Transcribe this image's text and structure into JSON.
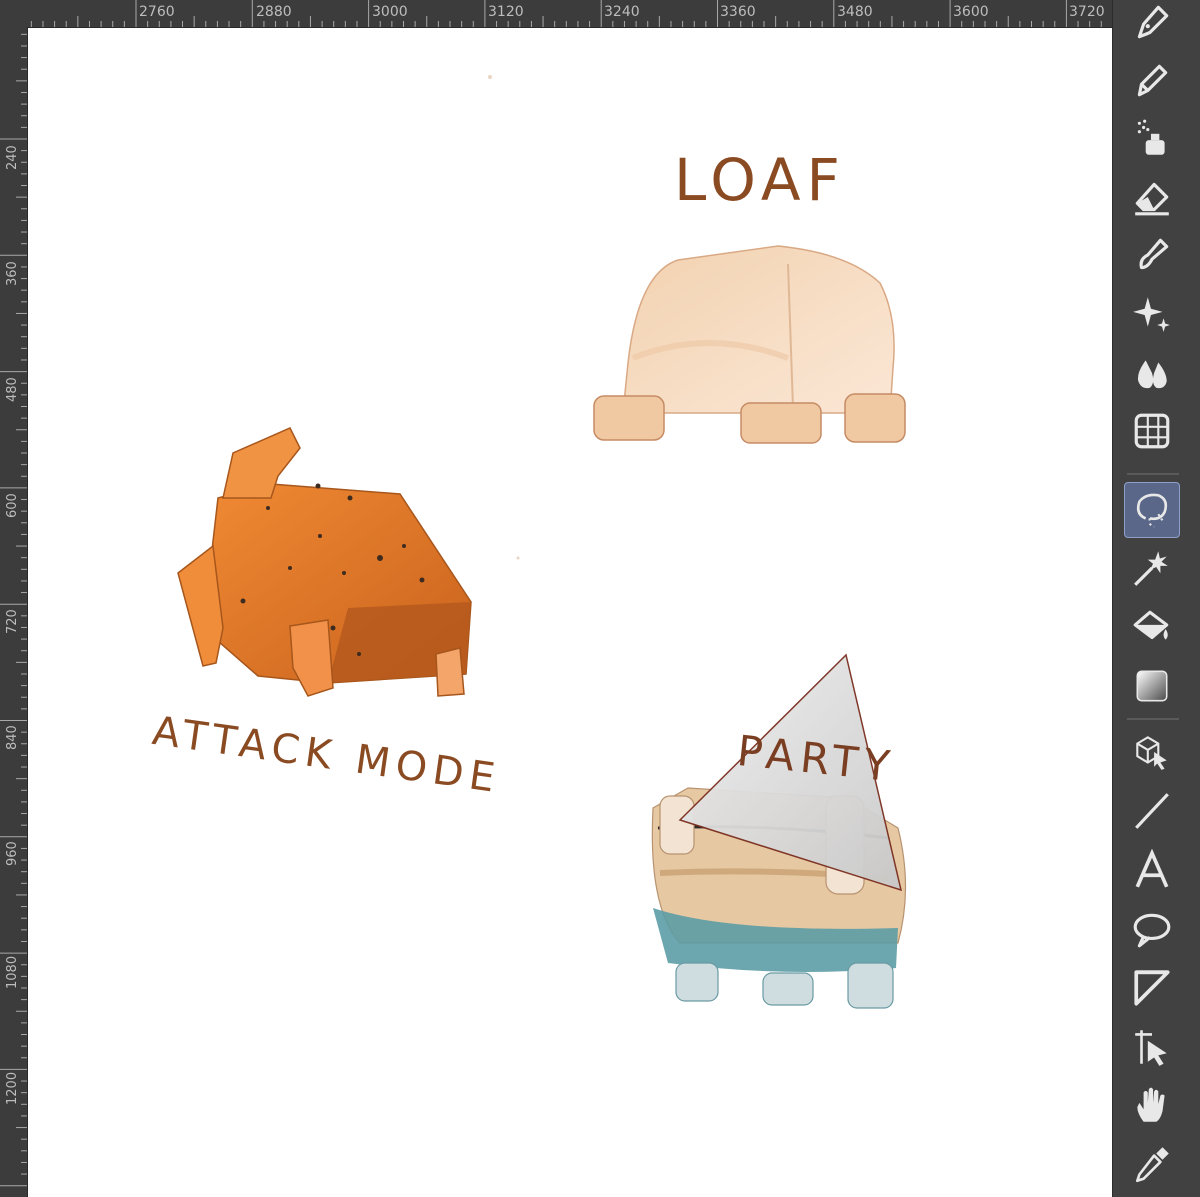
{
  "ruler": {
    "top": [
      "2760",
      "2880",
      "3000",
      "3120",
      "3240",
      "3360",
      "3480",
      "3600",
      "3720"
    ],
    "left": [
      "240",
      "360",
      "480",
      "600",
      "720",
      "840",
      "960",
      "1080",
      "1200"
    ]
  },
  "canvas": {
    "labels": {
      "loaf": "LOAF",
      "attack": "ATTACK MODE",
      "party": "PARTY"
    }
  },
  "toolbar": {
    "tools": [
      {
        "name": "pen",
        "icon": "pen-nib-icon",
        "active": false
      },
      {
        "name": "pencil",
        "icon": "pencil-icon",
        "active": false
      },
      {
        "name": "airbrush",
        "icon": "airbrush-icon",
        "active": false
      },
      {
        "name": "eraser",
        "icon": "eraser-icon",
        "active": false
      },
      {
        "name": "brush",
        "icon": "brush-icon",
        "active": false
      },
      {
        "name": "decoration",
        "icon": "sparkle-icon",
        "active": false
      },
      {
        "name": "blend",
        "icon": "blend-drops-icon",
        "active": false
      },
      {
        "name": "frame-border",
        "icon": "frame-grid-icon",
        "active": false
      },
      {
        "name": "selection",
        "icon": "lasso-icon",
        "active": true
      },
      {
        "name": "auto-select",
        "icon": "magic-wand-icon",
        "active": false
      },
      {
        "name": "fill",
        "icon": "paint-bucket-icon",
        "active": false
      },
      {
        "name": "gradient",
        "icon": "gradient-icon",
        "active": false
      },
      {
        "name": "operation",
        "icon": "object-select-icon",
        "active": false
      },
      {
        "name": "figure",
        "icon": "line-icon",
        "active": false
      },
      {
        "name": "text",
        "icon": "text-icon",
        "active": false
      },
      {
        "name": "balloon",
        "icon": "speech-balloon-icon",
        "active": false
      },
      {
        "name": "ruler",
        "icon": "ruler-triangle-icon",
        "active": false
      },
      {
        "name": "move-layer",
        "icon": "move-layer-icon",
        "active": false
      },
      {
        "name": "hand",
        "icon": "hand-icon",
        "active": false
      },
      {
        "name": "eyedropper",
        "icon": "eyedropper-icon",
        "active": false
      }
    ]
  }
}
